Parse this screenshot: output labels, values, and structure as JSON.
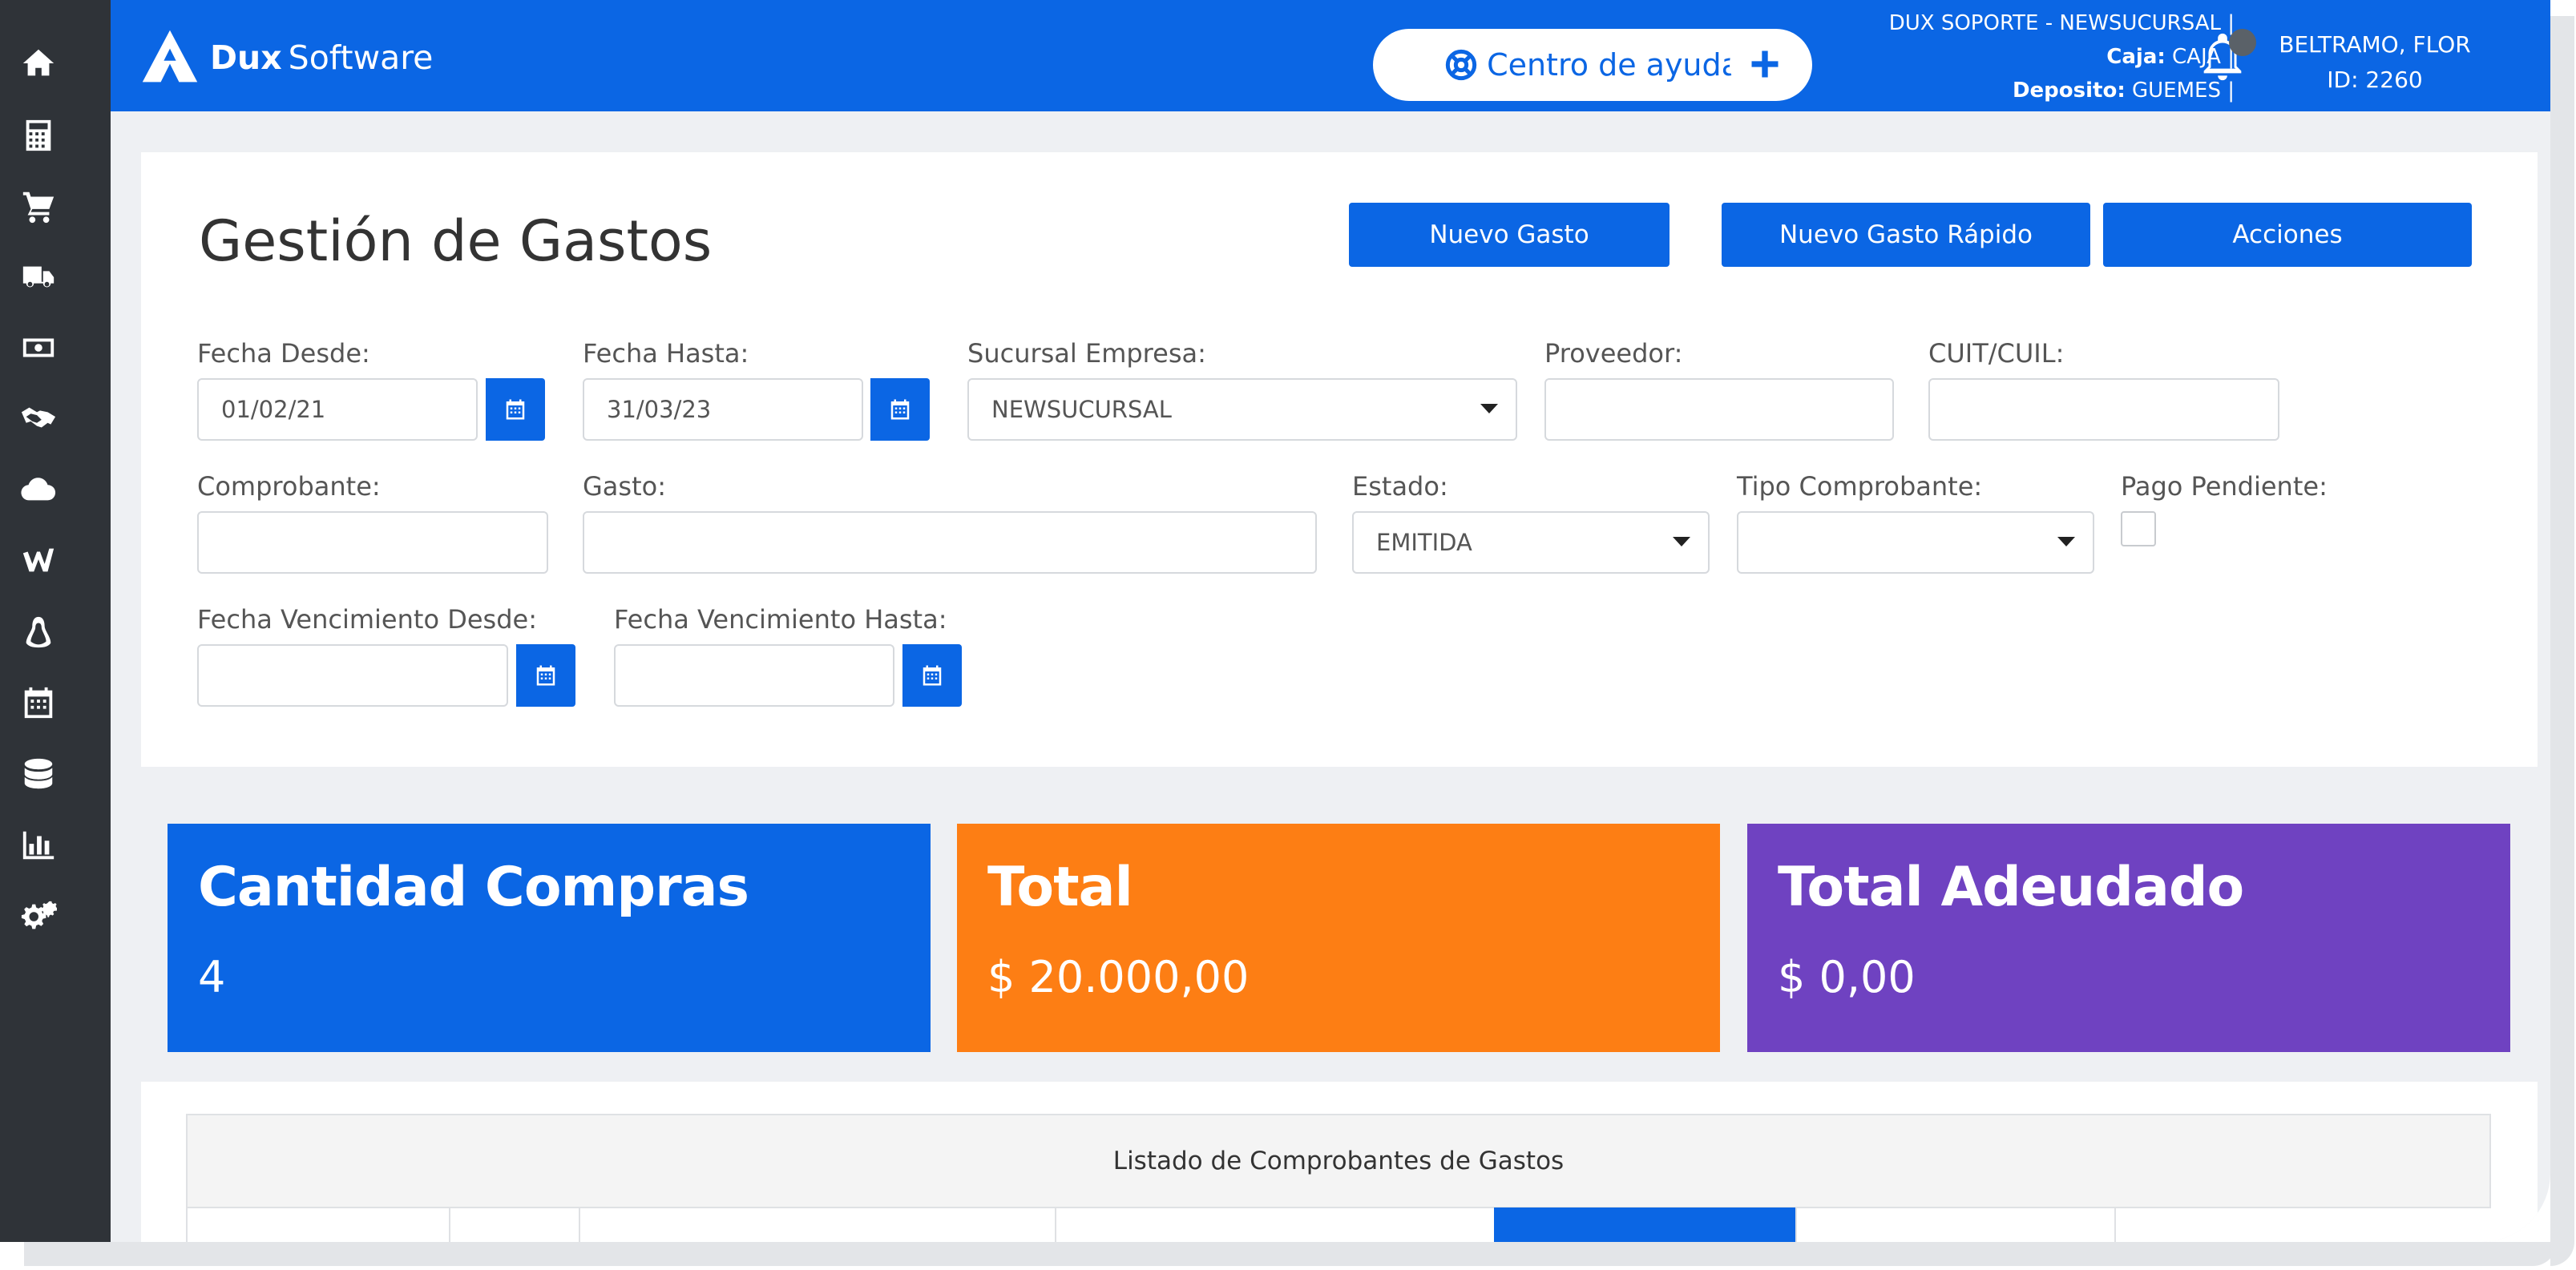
{
  "brand": {
    "name_bold": "Dux",
    "name_light": "Software"
  },
  "header": {
    "help_label": "Centro de ayuda",
    "add_icon": "plus-icon",
    "context_line1": "DUX SOPORTE - NEWSUCURSAL |",
    "caja_label": "Caja:",
    "caja_value": "CAJA |",
    "deposito_label": "Deposito:",
    "deposito_value": "GUEMES |",
    "user_name": "BELTRAMO, FLOR",
    "user_id": "ID: 2260"
  },
  "sidebar": {
    "icons": [
      "home-icon",
      "calculator-icon",
      "cart-icon",
      "truck-icon",
      "money-icon",
      "handshake-icon",
      "cloud-icon",
      "brand-w-icon",
      "linux-icon",
      "calendar-icon",
      "database-icon",
      "bar-chart-icon",
      "gears-icon"
    ]
  },
  "page": {
    "title": "Gestión de Gastos",
    "buttons": {
      "new": "Nuevo Gasto",
      "quick": "Nuevo Gasto Rápido",
      "actions": "Acciones"
    }
  },
  "filters": {
    "fecha_desde_label": "Fecha Desde:",
    "fecha_desde_value": "01/02/21",
    "fecha_hasta_label": "Fecha Hasta:",
    "fecha_hasta_value": "31/03/23",
    "sucursal_label": "Sucursal Empresa:",
    "sucursal_value": "NEWSUCURSAL",
    "proveedor_label": "Proveedor:",
    "proveedor_value": "",
    "cuit_label": "CUIT/CUIL:",
    "cuit_value": "",
    "comprobante_label": "Comprobante:",
    "comprobante_value": "",
    "gasto_label": "Gasto:",
    "gasto_value": "",
    "estado_label": "Estado:",
    "estado_value": "EMITIDA",
    "tipo_label": "Tipo Comprobante:",
    "tipo_value": "",
    "pago_pendiente_label": "Pago Pendiente:",
    "pago_pendiente_checked": false,
    "venc_desde_label": "Fecha Vencimiento Desde:",
    "venc_desde_value": "",
    "venc_hasta_label": "Fecha Vencimiento Hasta:",
    "venc_hasta_value": ""
  },
  "stats": [
    {
      "title": "Cantidad Compras",
      "value": "4",
      "color": "#0b66e4"
    },
    {
      "title": "Total",
      "value": "$ 20.000,00",
      "color": "#fd7e14"
    },
    {
      "title": "Total Adeudado",
      "value": "$ 0,00",
      "color": "#6f42c1"
    }
  ],
  "listing": {
    "title": "Listado de Comprobantes de Gastos"
  }
}
